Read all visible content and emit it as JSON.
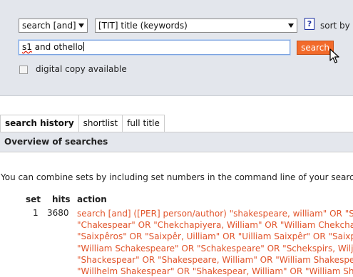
{
  "search_form": {
    "operator_select": "search [and]",
    "field_select": "[TIT] title (keywords)",
    "help_label": "?",
    "sort_label": "sort by",
    "query_word1": "s1",
    "query_rest": " and othello",
    "search_button": "search",
    "digital_copy_label": "digital copy available"
  },
  "tabs": [
    "search history",
    "shortlist",
    "full title"
  ],
  "overview_title": "Overview of searches",
  "info_text": "You can combine sets by including set numbers in the command line of your search r",
  "table": {
    "headers": {
      "set": "set",
      "hits": "hits",
      "action": "action"
    },
    "rows": [
      {
        "set": "1",
        "hits": "3680",
        "action_lines": [
          "search [and] ([PER] person/author) \"shakespeare, william\" OR \"Shake",
          "\"Chakespear\" OR \"Chekchapiyera, William\" OR \"William Chekchapiy",
          "\"Saixpêros\" OR \"Saixpêr, Uilliam\" OR \"Uilliam Saixpêr\" OR \"Saixpê",
          "\"William Schakespeare\" OR \"Schakespeare\" OR \"Schekspirs, Wiljan",
          "\"Shackespear\" OR \"Shakespeare, William\" OR \"William Shakespeare",
          "\"Willhelm Shakespear\" OR \"Shakespear, William\" OR \"William Shak"
        ]
      }
    ]
  },
  "colors": {
    "panel_bg": "#e3e6ec",
    "accent_orange": "#f26a2a",
    "action_link": "#e1542a"
  },
  "icons": {
    "select_arrow": "chevron-down-icon",
    "cursor": "mouse-pointer-icon"
  }
}
